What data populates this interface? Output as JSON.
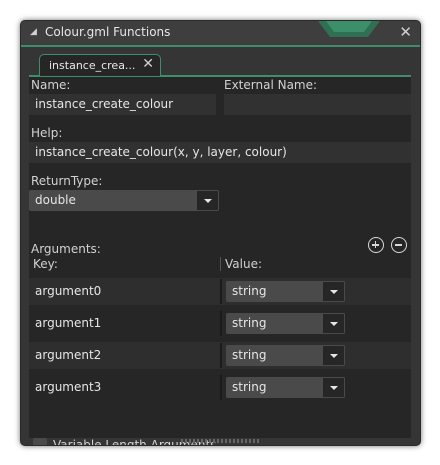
{
  "window": {
    "title": "Colour.gml Functions",
    "accent_color": "#3c8f6a"
  },
  "tab": {
    "label": "instance_crea...",
    "close": "✕"
  },
  "form": {
    "name_label": "Name:",
    "name_value": "instance_create_colour",
    "external_name_label": "External Name:",
    "external_name_value": "",
    "help_label": "Help:",
    "help_value": "instance_create_colour(x, y, layer, colour)",
    "return_type_label": "ReturnType:",
    "return_type_value": "double"
  },
  "arguments": {
    "label": "Arguments:",
    "key_header": "Key:",
    "value_header": "Value:",
    "rows": [
      {
        "key": "argument0",
        "value": "string"
      },
      {
        "key": "argument1",
        "value": "string"
      },
      {
        "key": "argument2",
        "value": "string"
      },
      {
        "key": "argument3",
        "value": "string"
      }
    ]
  },
  "variable_length": {
    "label": "Variable Length Arguments",
    "checked": false
  }
}
